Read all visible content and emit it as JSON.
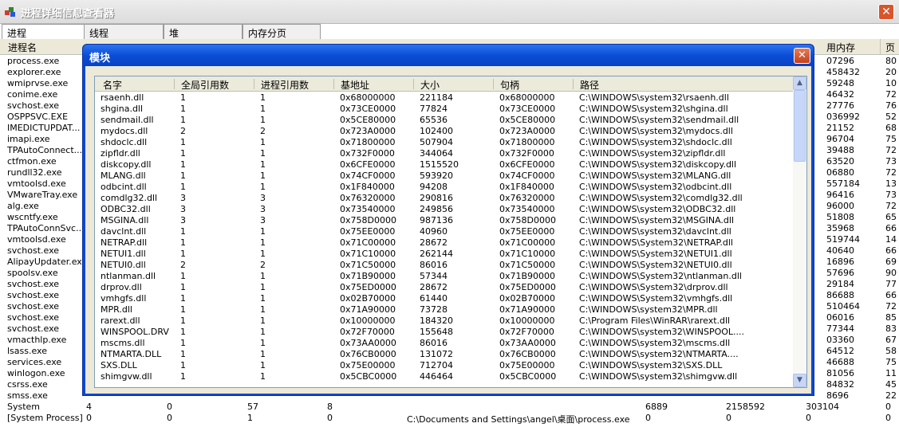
{
  "window": {
    "title": "进程详细信息查看器",
    "close_label": "✕"
  },
  "tabs": [
    {
      "label": "进程"
    },
    {
      "label": "线程"
    },
    {
      "label": "堆"
    },
    {
      "label": "内存分页"
    }
  ],
  "main_table": {
    "headers": [
      {
        "label": "进程名"
      },
      {
        "label": "用内存"
      },
      {
        "label": "页"
      }
    ],
    "rows": [
      {
        "name": "process.exe",
        "mem": "07296",
        "pg": "80"
      },
      {
        "name": "explorer.exe",
        "mem": "458432",
        "pg": "20"
      },
      {
        "name": "wmiprvse.exe",
        "mem": "59248",
        "pg": "10"
      },
      {
        "name": "conime.exe",
        "mem": "46432",
        "pg": "72"
      },
      {
        "name": "svchost.exe",
        "mem": "27776",
        "pg": "76"
      },
      {
        "name": "OSPPSVC.EXE",
        "mem": "036992",
        "pg": "52"
      },
      {
        "name": "IMEDICTUPDAT...",
        "mem": "21152",
        "pg": "68"
      },
      {
        "name": "imapi.exe",
        "mem": "96704",
        "pg": "75"
      },
      {
        "name": "TPAutoConnect....",
        "mem": "39488",
        "pg": "72"
      },
      {
        "name": "ctfmon.exe",
        "mem": "63520",
        "pg": "73"
      },
      {
        "name": "rundll32.exe",
        "mem": "06880",
        "pg": "72"
      },
      {
        "name": "vmtoolsd.exe",
        "mem": "557184",
        "pg": "13"
      },
      {
        "name": "VMwareTray.exe",
        "mem": "96416",
        "pg": "73"
      },
      {
        "name": "alg.exe",
        "mem": "96000",
        "pg": "72"
      },
      {
        "name": "wscntfy.exe",
        "mem": "51808",
        "pg": "65"
      },
      {
        "name": "TPAutoConnSvc...",
        "mem": "35968",
        "pg": "66"
      },
      {
        "name": "vmtoolsd.exe",
        "mem": "519744",
        "pg": "14"
      },
      {
        "name": "svchost.exe",
        "mem": "40640",
        "pg": "66"
      },
      {
        "name": "AlipayUpdater.exe",
        "mem": "16896",
        "pg": "69"
      },
      {
        "name": "spoolsv.exe",
        "mem": "57696",
        "pg": "90"
      },
      {
        "name": "svchost.exe",
        "mem": "29184",
        "pg": "77"
      },
      {
        "name": "svchost.exe",
        "mem": "86688",
        "pg": "66"
      },
      {
        "name": "svchost.exe",
        "mem": "510464",
        "pg": "72"
      },
      {
        "name": "svchost.exe",
        "mem": "06016",
        "pg": "85"
      },
      {
        "name": "svchost.exe",
        "mem": "77344",
        "pg": "83"
      },
      {
        "name": "vmacthlp.exe",
        "mem": "03360",
        "pg": "67"
      },
      {
        "name": "lsass.exe",
        "mem": "64512",
        "pg": "58"
      },
      {
        "name": "services.exe",
        "mem": "46688",
        "pg": "75"
      },
      {
        "name": "winlogon.exe",
        "mem": "81056",
        "pg": "11"
      },
      {
        "name": "csrss.exe",
        "mem": "84832",
        "pg": "45"
      },
      {
        "name": "smss.exe",
        "mem": "8696",
        "pg": "22"
      }
    ],
    "full_rows": [
      {
        "name": "System",
        "c1": "4",
        "c2": "0",
        "c3": "57",
        "c4": "8",
        "c5": "",
        "c6": "6889",
        "c7": "2158592",
        "c8": "303104",
        "c9": "0"
      },
      {
        "name": "[System Process]",
        "c1": "0",
        "c2": "0",
        "c3": "1",
        "c4": "0",
        "c5": "C:\\Documents and Settings\\angel\\桌面\\process.exe",
        "c6": "0",
        "c7": "0",
        "c8": "0",
        "c9": "0"
      }
    ]
  },
  "module_dialog": {
    "title": "模块",
    "close_label": "✕",
    "headers": [
      {
        "label": "名字"
      },
      {
        "label": "全局引用数"
      },
      {
        "label": "进程引用数"
      },
      {
        "label": "基地址"
      },
      {
        "label": "大小"
      },
      {
        "label": "句柄"
      },
      {
        "label": "路径"
      }
    ],
    "rows": [
      {
        "name": "rsaenh.dll",
        "g": "1",
        "p": "1",
        "base": "0x68000000",
        "size": "221184",
        "handle": "0x68000000",
        "path": "C:\\WINDOWS\\system32\\rsaenh.dll"
      },
      {
        "name": "shgina.dll",
        "g": "1",
        "p": "1",
        "base": "0x73CE0000",
        "size": "77824",
        "handle": "0x73CE0000",
        "path": "C:\\WINDOWS\\system32\\shgina.dll"
      },
      {
        "name": "sendmail.dll",
        "g": "1",
        "p": "1",
        "base": "0x5CE80000",
        "size": "65536",
        "handle": "0x5CE80000",
        "path": "C:\\WINDOWS\\system32\\sendmail.dll"
      },
      {
        "name": "mydocs.dll",
        "g": "2",
        "p": "2",
        "base": "0x723A0000",
        "size": "102400",
        "handle": "0x723A0000",
        "path": "C:\\WINDOWS\\system32\\mydocs.dll"
      },
      {
        "name": "shdoclc.dll",
        "g": "1",
        "p": "1",
        "base": "0x71800000",
        "size": "507904",
        "handle": "0x71800000",
        "path": "C:\\WINDOWS\\system32\\shdoclc.dll"
      },
      {
        "name": "zipfldr.dll",
        "g": "1",
        "p": "1",
        "base": "0x732F0000",
        "size": "344064",
        "handle": "0x732F0000",
        "path": "C:\\WINDOWS\\system32\\zipfldr.dll"
      },
      {
        "name": "diskcopy.dll",
        "g": "1",
        "p": "1",
        "base": "0x6CFE0000",
        "size": "1515520",
        "handle": "0x6CFE0000",
        "path": "C:\\WINDOWS\\system32\\diskcopy.dll"
      },
      {
        "name": "MLANG.dll",
        "g": "1",
        "p": "1",
        "base": "0x74CF0000",
        "size": "593920",
        "handle": "0x74CF0000",
        "path": "C:\\WINDOWS\\system32\\MLANG.dll"
      },
      {
        "name": "odbcint.dll",
        "g": "1",
        "p": "1",
        "base": "0x1F840000",
        "size": "94208",
        "handle": "0x1F840000",
        "path": "C:\\WINDOWS\\system32\\odbcint.dll"
      },
      {
        "name": "comdlg32.dll",
        "g": "3",
        "p": "3",
        "base": "0x76320000",
        "size": "290816",
        "handle": "0x76320000",
        "path": "C:\\WINDOWS\\system32\\comdlg32.dll"
      },
      {
        "name": "ODBC32.dll",
        "g": "3",
        "p": "3",
        "base": "0x73540000",
        "size": "249856",
        "handle": "0x73540000",
        "path": "C:\\WINDOWS\\system32\\ODBC32.dll"
      },
      {
        "name": "MSGINA.dll",
        "g": "3",
        "p": "3",
        "base": "0x758D0000",
        "size": "987136",
        "handle": "0x758D0000",
        "path": "C:\\WINDOWS\\system32\\MSGINA.dll"
      },
      {
        "name": "davclnt.dll",
        "g": "1",
        "p": "1",
        "base": "0x75EE0000",
        "size": "40960",
        "handle": "0x75EE0000",
        "path": "C:\\WINDOWS\\system32\\davclnt.dll"
      },
      {
        "name": "NETRAP.dll",
        "g": "1",
        "p": "1",
        "base": "0x71C00000",
        "size": "28672",
        "handle": "0x71C00000",
        "path": "C:\\WINDOWS\\System32\\NETRAP.dll"
      },
      {
        "name": "NETUI1.dll",
        "g": "1",
        "p": "1",
        "base": "0x71C10000",
        "size": "262144",
        "handle": "0x71C10000",
        "path": "C:\\WINDOWS\\System32\\NETUI1.dll"
      },
      {
        "name": "NETUI0.dll",
        "g": "2",
        "p": "2",
        "base": "0x71C50000",
        "size": "86016",
        "handle": "0x71C50000",
        "path": "C:\\WINDOWS\\System32\\NETUI0.dll"
      },
      {
        "name": "ntlanman.dll",
        "g": "1",
        "p": "1",
        "base": "0x71B90000",
        "size": "57344",
        "handle": "0x71B90000",
        "path": "C:\\WINDOWS\\System32\\ntlanman.dll"
      },
      {
        "name": "drprov.dll",
        "g": "1",
        "p": "1",
        "base": "0x75ED0000",
        "size": "28672",
        "handle": "0x75ED0000",
        "path": "C:\\WINDOWS\\System32\\drprov.dll"
      },
      {
        "name": "vmhgfs.dll",
        "g": "1",
        "p": "1",
        "base": "0x02B70000",
        "size": "61440",
        "handle": "0x02B70000",
        "path": "C:\\WINDOWS\\System32\\vmhgfs.dll"
      },
      {
        "name": "MPR.dll",
        "g": "1",
        "p": "1",
        "base": "0x71A90000",
        "size": "73728",
        "handle": "0x71A90000",
        "path": "C:\\WINDOWS\\system32\\MPR.dll"
      },
      {
        "name": "rarext.dll",
        "g": "1",
        "p": "1",
        "base": "0x10000000",
        "size": "184320",
        "handle": "0x10000000",
        "path": "C:\\Program Files\\WinRAR\\rarext.dll"
      },
      {
        "name": "WINSPOOL.DRV",
        "g": "1",
        "p": "1",
        "base": "0x72F70000",
        "size": "155648",
        "handle": "0x72F70000",
        "path": "C:\\WINDOWS\\system32\\WINSPOOL...."
      },
      {
        "name": "mscms.dll",
        "g": "1",
        "p": "1",
        "base": "0x73AA0000",
        "size": "86016",
        "handle": "0x73AA0000",
        "path": "C:\\WINDOWS\\system32\\mscms.dll"
      },
      {
        "name": "NTMARTA.DLL",
        "g": "1",
        "p": "1",
        "base": "0x76CB0000",
        "size": "131072",
        "handle": "0x76CB0000",
        "path": "C:\\WINDOWS\\system32\\NTMARTA...."
      },
      {
        "name": "SXS.DLL",
        "g": "1",
        "p": "1",
        "base": "0x75E00000",
        "size": "712704",
        "handle": "0x75E00000",
        "path": "C:\\WINDOWS\\system32\\SXS.DLL"
      },
      {
        "name": "shimgvw.dll",
        "g": "1",
        "p": "1",
        "base": "0x5CBC0000",
        "size": "446464",
        "handle": "0x5CBC0000",
        "path": "C:\\WINDOWS\\system32\\shimgvw.dll"
      }
    ]
  },
  "colors": {
    "title_bar": "#0a4ed6",
    "dialog_bg": "#ece9d8",
    "close_red": "#d9552c"
  }
}
